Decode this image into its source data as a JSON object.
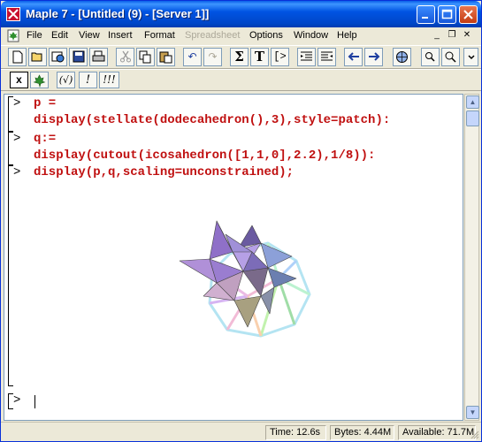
{
  "window": {
    "title": "Maple 7  - [Untitled (9) - [Server 1]]"
  },
  "menubar": {
    "items": [
      {
        "label": "File",
        "enabled": true
      },
      {
        "label": "Edit",
        "enabled": true
      },
      {
        "label": "View",
        "enabled": true
      },
      {
        "label": "Insert",
        "enabled": true
      },
      {
        "label": "Format",
        "enabled": true
      },
      {
        "label": "Spreadsheet",
        "enabled": false
      },
      {
        "label": "Options",
        "enabled": true
      },
      {
        "label": "Window",
        "enabled": true
      },
      {
        "label": "Help",
        "enabled": true
      }
    ]
  },
  "toolbar": {
    "sum_label": "Σ",
    "text_label": "T",
    "math_label": "[>",
    "undo_label": "↶",
    "redo_label": "↷"
  },
  "context_toolbar": {
    "items": [
      "x",
      "maple-leaf",
      "(√)",
      "!",
      "!!!"
    ],
    "x_label": "x",
    "sqrt_label": "(√)",
    "bang_label": "!",
    "bangs_label": "!!!"
  },
  "worksheet": {
    "prompt": ">",
    "inputs": [
      {
        "line1": "p =",
        "line2": "display(stellate(dodecahedron(),3),style=patch):"
      },
      {
        "line1": "q:=",
        "line2": "display(cutout(icosahedron([1,1,0],2.2),1/8)):"
      },
      {
        "line1": "display(p,q,scaling=unconstrained);"
      }
    ],
    "output": {
      "type": "3d-plot",
      "description_icon": "stellated-dodecahedron-and-cutout-icosahedron"
    }
  },
  "statusbar": {
    "time": "Time:  12.6s",
    "bytes": "Bytes: 4.44M",
    "available": "Available: 71.7M"
  },
  "colors": {
    "titlebar": "#0054e3",
    "input_text": "#c01010",
    "chrome": "#ece9d8"
  }
}
